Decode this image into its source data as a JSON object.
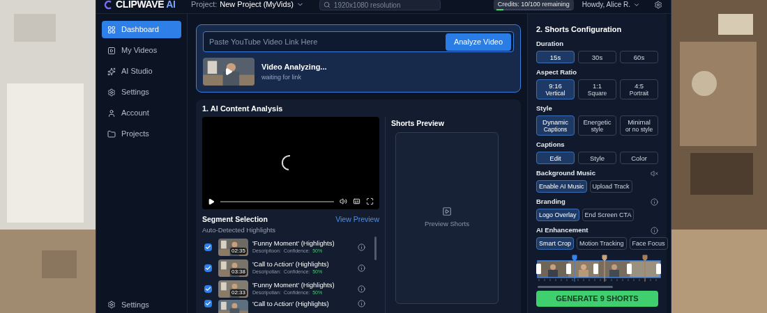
{
  "header": {
    "logo": "CLIPWAVE",
    "logo_accent": "AI",
    "project_label": "Project:",
    "project_name": "New Project (MyVids)",
    "search_placeholder": "1920x1080 resolution",
    "credits": {
      "text": "Credits: 10/100 remaining",
      "level": 0.1
    },
    "user": "Howdy, Alice R."
  },
  "sidebar": {
    "items": [
      {
        "label": "Dashboard",
        "selected": true
      },
      {
        "label": "My Videos",
        "selected": false
      },
      {
        "label": "AI Studio",
        "selected": false
      },
      {
        "label": "Settings",
        "selected": false
      },
      {
        "label": "Account",
        "selected": false
      },
      {
        "label": "Projects",
        "selected": false
      }
    ],
    "footer": "Settings"
  },
  "url_card": {
    "placeholder": "Paste YouTube Video Link Here",
    "button": "Analyze Video",
    "status_title": "Video Analyzing...",
    "status_subtitle": "waiting for link"
  },
  "analysis": {
    "title": "1. AI Content Analysis",
    "segments": {
      "title": "Segment Selection",
      "link": "View Preview",
      "subtitle": "Auto-Detected Highlights",
      "rows": [
        {
          "checked": true,
          "time": "02:35",
          "title": "'Funny Moment' (Highlights)",
          "description": "Descripitoon:",
          "confidence_label": "Confidence:",
          "confidence_value": "50%"
        },
        {
          "checked": true,
          "time": "03:38",
          "title": "'Call to Action' (Highlights)",
          "description": "Descripotian:",
          "confidence_label": "Confidence:",
          "confidence_value": "50%"
        },
        {
          "checked": true,
          "time": "02:33",
          "title": "'Funny Moment' (Highlights)",
          "description": "Descripotian:",
          "confidence_label": "Confidence:",
          "confidence_value": "50%"
        },
        {
          "checked": true,
          "title": "'Call to Action' (Highlights)"
        }
      ]
    },
    "preview": {
      "title": "Shorts Preview",
      "label": "Preview Shorts"
    }
  },
  "config": {
    "title": "2. Shorts Configuration",
    "groups": [
      {
        "label": "Duration",
        "kind": "grid",
        "options": [
          {
            "label": "15s",
            "selected": true
          },
          {
            "label": "30s",
            "selected": false
          },
          {
            "label": "60s",
            "selected": false
          }
        ]
      },
      {
        "label": "Aspect Ratio",
        "kind": "grid",
        "options": [
          {
            "label": "9:16",
            "sublabel": "Vertical",
            "selected": true
          },
          {
            "label": "1:1",
            "sublabel": "Square",
            "selected": false
          },
          {
            "label": "4:5",
            "sublabel": "Portrait",
            "selected": false
          }
        ]
      },
      {
        "label": "Style",
        "kind": "grid",
        "options": [
          {
            "label": "Dynamic",
            "sublabel": "Captions",
            "selected": true
          },
          {
            "label": "Energetic",
            "sublabel": "style",
            "selected": false
          },
          {
            "label": "Minimal",
            "sublabel": "or no style",
            "selected": false
          }
        ]
      },
      {
        "label": "Captions",
        "kind": "grid",
        "options": [
          {
            "label": "Edit",
            "selected": true
          },
          {
            "label": "Style",
            "selected": false
          },
          {
            "label": "Color",
            "selected": false
          }
        ]
      },
      {
        "label": "Background Music",
        "kind": "chips",
        "options": [
          {
            "label": "Enable AI Music",
            "selected": true
          },
          {
            "label": "Upload Track",
            "selected": false
          }
        ]
      },
      {
        "label": "Branding",
        "kind": "chips",
        "options": [
          {
            "label": "Logo Overlay",
            "selected": true
          },
          {
            "label": "End Screen CTA",
            "selected": false
          }
        ]
      },
      {
        "label": "AI Enhancement",
        "kind": "chips",
        "options": [
          {
            "label": "Smart Crop",
            "selected": true
          },
          {
            "label": "Motion Tracking",
            "selected": false
          },
          {
            "label": "Face Focus",
            "selected": false
          }
        ]
      }
    ],
    "generate_button": "GENERATE 9 SHORTS"
  }
}
